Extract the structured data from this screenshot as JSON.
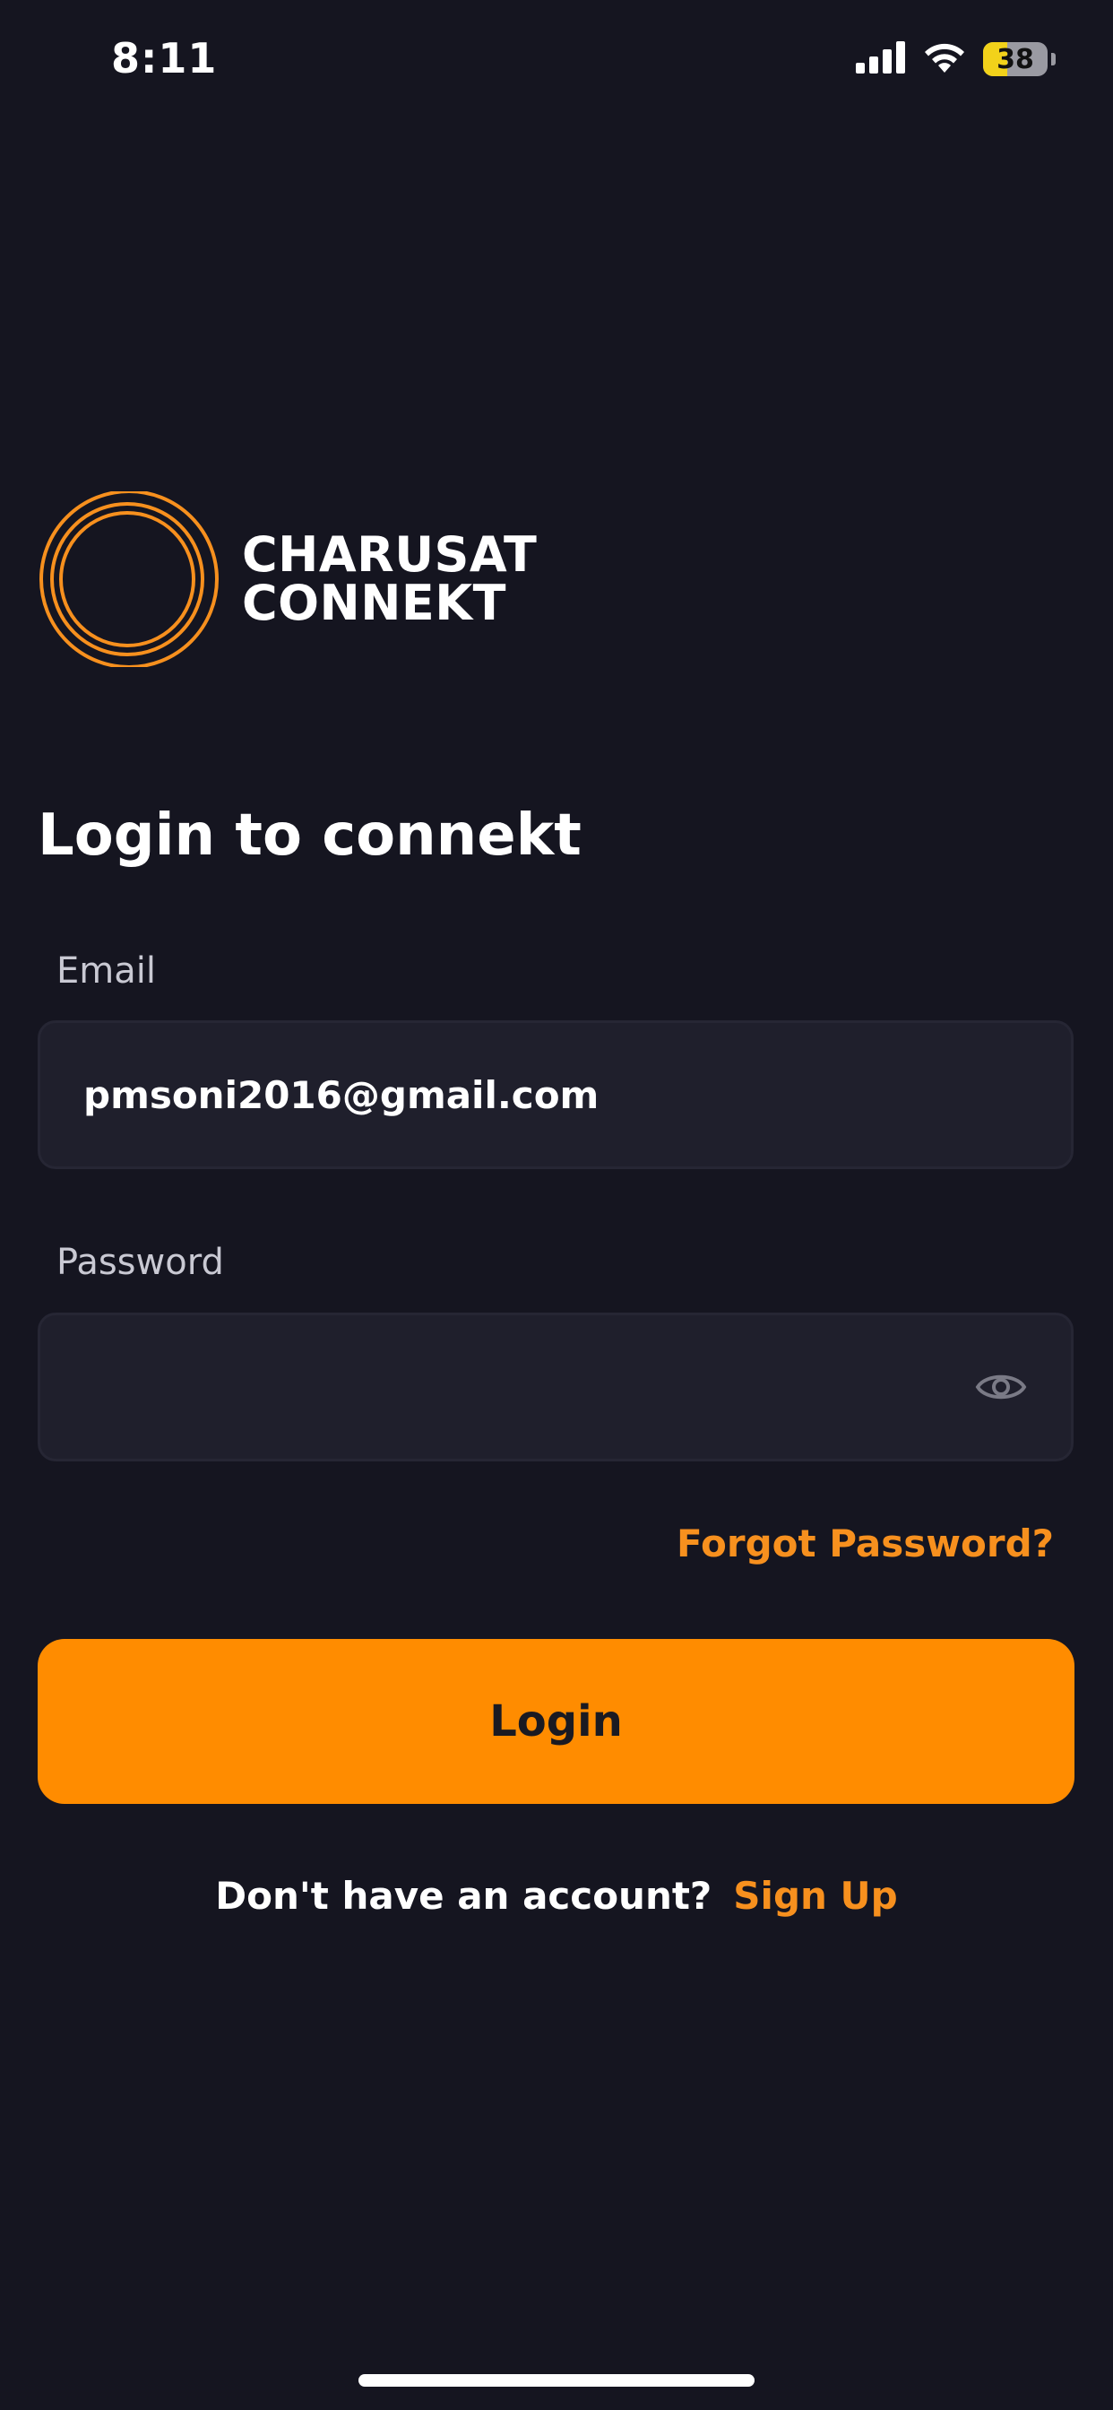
{
  "status_bar": {
    "time": "8:11",
    "battery_level": "38",
    "battery_fraction": 0.38,
    "icons": [
      "cellular-signal-icon",
      "wifi-icon",
      "battery-icon"
    ]
  },
  "brand": {
    "line1": "CHARUSAT",
    "line2": "CONNEKT",
    "logo_icon": "concentric-rings-logo",
    "accent_color": "#F7901E"
  },
  "login": {
    "heading": "Login to connekt",
    "email": {
      "label": "Email",
      "value": "pmsoni2016@gmail.com"
    },
    "password": {
      "label": "Password",
      "value": "",
      "toggle_icon": "eye-icon"
    },
    "forgot_password": "Forgot Password?",
    "submit_label": "Login",
    "signup_prompt": "Don't have an account?",
    "signup_link": "Sign Up"
  },
  "colors": {
    "background": "#151520",
    "input_background": "#1F1F2C",
    "primary_button": "#FF8C00",
    "link": "#F7901E"
  }
}
